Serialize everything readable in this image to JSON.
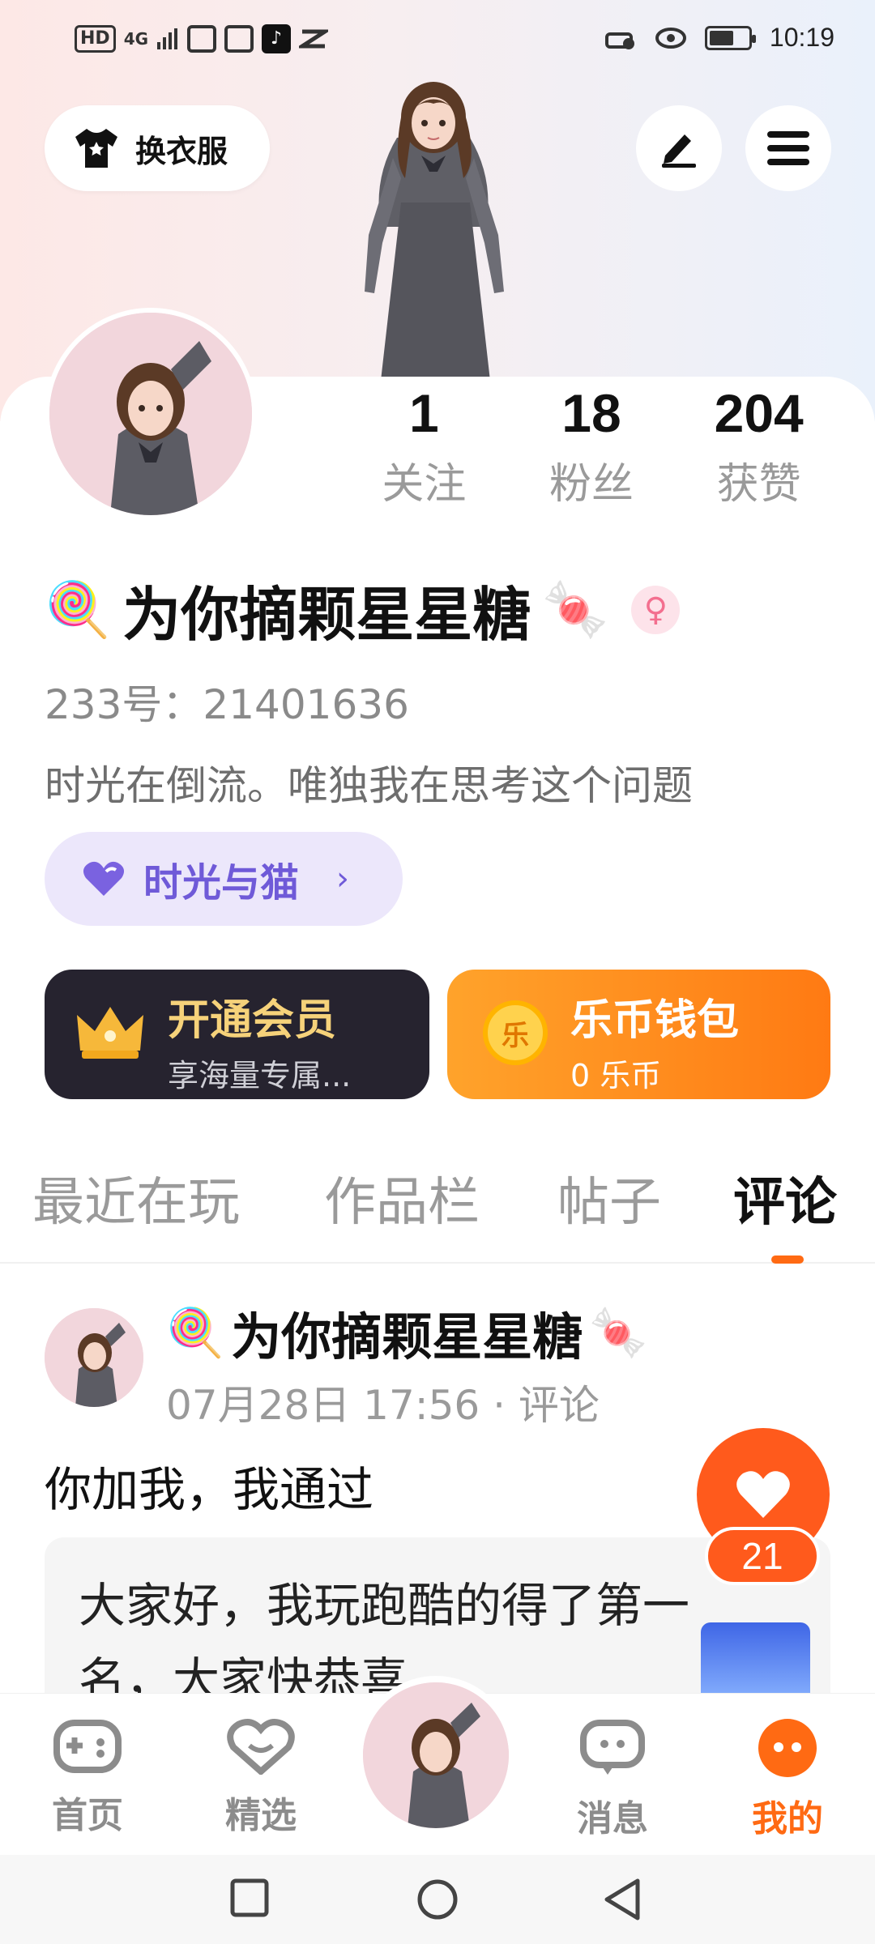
{
  "status_bar": {
    "hd": "HD",
    "signal": "4G",
    "time": "10:19"
  },
  "header": {
    "outfit_button": "换衣服"
  },
  "profile": {
    "stats": [
      {
        "value": "1",
        "label": "关注"
      },
      {
        "value": "18",
        "label": "粉丝"
      },
      {
        "value": "204",
        "label": "获赞"
      }
    ],
    "name_prefix_emoji": "🍭",
    "name": "为你摘颗星星糖",
    "name_suffix_emoji": "🍬",
    "gender_symbol": "♀",
    "uid": "233号：21401636",
    "bio": "时光在倒流。唯独我在思考这个问题",
    "group": {
      "label": "时光与猫",
      "chevron": "›"
    }
  },
  "cards": {
    "vip": {
      "title": "开通会员",
      "subtitle": "享海量专属..."
    },
    "wallet": {
      "title": "乐币钱包",
      "subtitle": "0 乐币",
      "coin_glyph": "乐"
    }
  },
  "tabs": [
    {
      "label": "最近在玩",
      "active": false
    },
    {
      "label": "作品栏",
      "active": false
    },
    {
      "label": "帖子",
      "active": false
    },
    {
      "label": "评论",
      "active": true
    }
  ],
  "post": {
    "author_prefix_emoji": "🍭",
    "author": "为你摘颗星星糖",
    "author_suffix_emoji": "🍬",
    "meta": "07月28日 17:56 · 评论",
    "text": "你加我，我通过",
    "quote": "大家好，我玩跑酷的得了第一名，大家快恭喜",
    "likes": "21"
  },
  "bottom_nav": [
    {
      "label": "首页",
      "icon": "gamepad-icon",
      "active": false
    },
    {
      "label": "精选",
      "icon": "heart-bubble-icon",
      "active": false
    },
    {
      "label": "消息",
      "icon": "chat-icon",
      "active": false
    },
    {
      "label": "我的",
      "icon": "profile-dots-icon",
      "active": true
    }
  ],
  "colors": {
    "accent": "#ff6a13",
    "group_purple": "#6f5ad8",
    "vip_gold": "#f6d27a"
  }
}
